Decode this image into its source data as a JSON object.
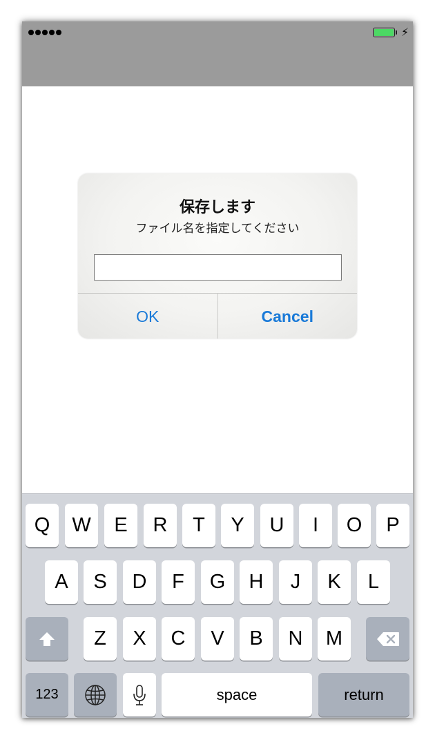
{
  "status_bar": {
    "signal_dots": 5,
    "battery_level": 1.0,
    "battery_color": "#4cd964",
    "charging_icon": "bolt-icon"
  },
  "alert": {
    "title": "保存します",
    "message": "ファイル名を指定してください",
    "input": {
      "value": "",
      "placeholder": ""
    },
    "buttons": {
      "ok": "OK",
      "cancel": "Cancel"
    },
    "button_color": "#1a7ad8"
  },
  "keyboard": {
    "row1": [
      "Q",
      "W",
      "E",
      "R",
      "T",
      "Y",
      "U",
      "I",
      "O",
      "P"
    ],
    "row2": [
      "A",
      "S",
      "D",
      "F",
      "G",
      "H",
      "J",
      "K",
      "L"
    ],
    "row3": [
      "Z",
      "X",
      "C",
      "V",
      "B",
      "N",
      "M"
    ],
    "shift_icon": "shift-arrow-icon",
    "delete_icon": "delete-backspace-icon",
    "numbers_label": "123",
    "globe_icon": "globe-icon",
    "mic_icon": "microphone-icon",
    "space_label": "space",
    "return_label": "return"
  }
}
